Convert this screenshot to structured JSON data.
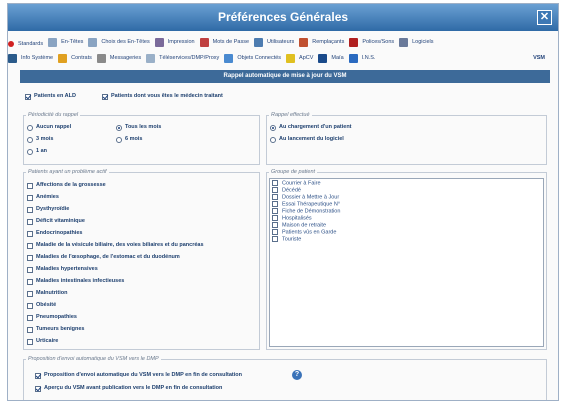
{
  "window": {
    "title": "Préférences Générales"
  },
  "tabs_row1": [
    {
      "label": "Standards",
      "icon": "dot-red-icon",
      "color": "#d02020"
    },
    {
      "label": "En-Têtes",
      "icon": "header-icon",
      "color": "#8aa4c2"
    },
    {
      "label": "Choix des En-Têtes",
      "icon": "header-choice-icon",
      "color": "#8aa4c2"
    },
    {
      "label": "Impression",
      "icon": "printer-icon",
      "color": "#7a6a9a"
    },
    {
      "label": "Mots de Passe",
      "icon": "key-icon",
      "color": "#c04040"
    },
    {
      "label": "Utilisateurs",
      "icon": "users-icon",
      "color": "#4d7cb0"
    },
    {
      "label": "Remplaçants",
      "icon": "replacement-icon",
      "color": "#c05030"
    },
    {
      "label": "Polices/Sons",
      "icon": "font-icon",
      "color": "#b02020"
    },
    {
      "label": "Logiciels",
      "icon": "software-icon",
      "color": "#6a7a9a"
    }
  ],
  "tabs_row2": [
    {
      "label": "Info Système",
      "icon": "info-icon",
      "color": "#2a5a8a"
    },
    {
      "label": "Contrats",
      "icon": "pen-icon",
      "color": "#e0a020"
    },
    {
      "label": "Messageries",
      "icon": "mail-icon",
      "color": "#8a8a8a"
    },
    {
      "label": "Téléservices/DMP/Proxy",
      "icon": "teleservice-icon",
      "color": "#9ab0c8"
    },
    {
      "label": "Objets Connectés",
      "icon": "connected-icon",
      "color": "#4a8ad0"
    },
    {
      "label": "ApCV",
      "icon": "apcv-icon",
      "color": "#e0c020"
    },
    {
      "label": "Maïa",
      "icon": "maia-icon",
      "color": "#1a4a8a"
    },
    {
      "label": "I.N.S.",
      "icon": "ins-icon",
      "color": "#2a6ac0"
    },
    {
      "label": "VSM",
      "icon": "",
      "color": ""
    }
  ],
  "section_title": "Rappel automatique de mise à jour du VSM",
  "top_options": [
    {
      "label": "Patients en ALD",
      "checked": true
    },
    {
      "label": "Patients dont vous êtes le médecin traitant",
      "checked": true
    }
  ],
  "periodicite": {
    "legend": "Périodicité du rappel",
    "options": [
      "Aucun rappel",
      "Tous les mois",
      "3 mois",
      "6 mois",
      "1 an"
    ],
    "selected": "Tous les mois"
  },
  "rappel": {
    "legend": "Rappel effectué",
    "options": [
      "Au chargement d'un patient",
      "Au lancement du logiciel"
    ],
    "selected": "Au chargement d'un patient"
  },
  "problemes": {
    "legend": "Patients ayant un problème actif",
    "items": [
      "Affections de la grossesse",
      "Anémies",
      "Dysthyroïdie",
      "Déficit vitaminique",
      "Endocrinopathies",
      "Maladie de la vésicule biliaire, des voies biliaires et du pancréas",
      "Maladies de l'œsophage, de l'estomac et du duodénum",
      "Maladies hypertensives",
      "Maladies intestinales infectieuses",
      "Malnutrition",
      "Obésité",
      "Pneumopathies",
      "Tumeurs benignes",
      "Urticaire"
    ]
  },
  "groupes": {
    "legend": "Groupe de patient",
    "items": [
      "Courrier à Faire",
      "Décédé",
      "Dossier à Mettre à Jour",
      "Essai Thérapeutique N°",
      "Fiche de Démonstration",
      "Hospitalisés",
      "Maison de retraite",
      "Patients vûs en Garde",
      "Touriste"
    ]
  },
  "dmp": {
    "legend": "Proposition d'envoi automatique du VSM vers le DMP",
    "options": [
      {
        "label": "Proposition d'envoi automatique du VSM vers le DMP en fin de consultation",
        "checked": true
      },
      {
        "label": "Aperçu du VSM avant publication vers le DMP en fin de consultation",
        "checked": true
      }
    ]
  },
  "colors": {
    "title_bar": "#3a74b0",
    "section_bar": "#3d6a99",
    "text": "#1d3f6e"
  }
}
